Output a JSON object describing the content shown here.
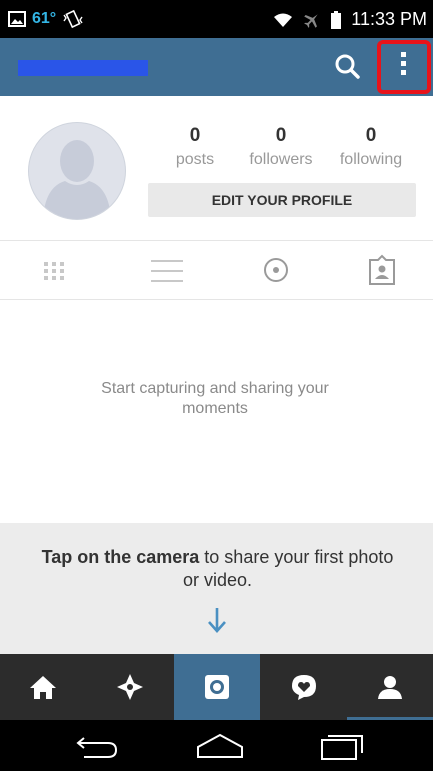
{
  "status_bar": {
    "temperature": "61°",
    "time": "11:33 PM"
  },
  "profile": {
    "stats": [
      {
        "count": "0",
        "label": "posts"
      },
      {
        "count": "0",
        "label": "followers"
      },
      {
        "count": "0",
        "label": "following"
      }
    ],
    "edit_button": "EDIT YOUR PROFILE"
  },
  "tabs": [
    {
      "icon": "grid-icon"
    },
    {
      "icon": "list-icon"
    },
    {
      "icon": "location-pin-icon"
    },
    {
      "icon": "tagged-person-icon"
    }
  ],
  "empty_state": {
    "message": "Start capturing and sharing your moments",
    "tap_bold": "Tap on the camera",
    "tap_rest": " to share your first photo or video."
  },
  "bottom_nav": [
    {
      "icon": "home-icon"
    },
    {
      "icon": "explore-icon"
    },
    {
      "icon": "camera-icon"
    },
    {
      "icon": "activity-icon"
    },
    {
      "icon": "profile-icon"
    }
  ],
  "colors": {
    "action_bar": "#3f6e93",
    "highlight_box": "#e8131a",
    "nav_background": "#2c2c2c"
  }
}
